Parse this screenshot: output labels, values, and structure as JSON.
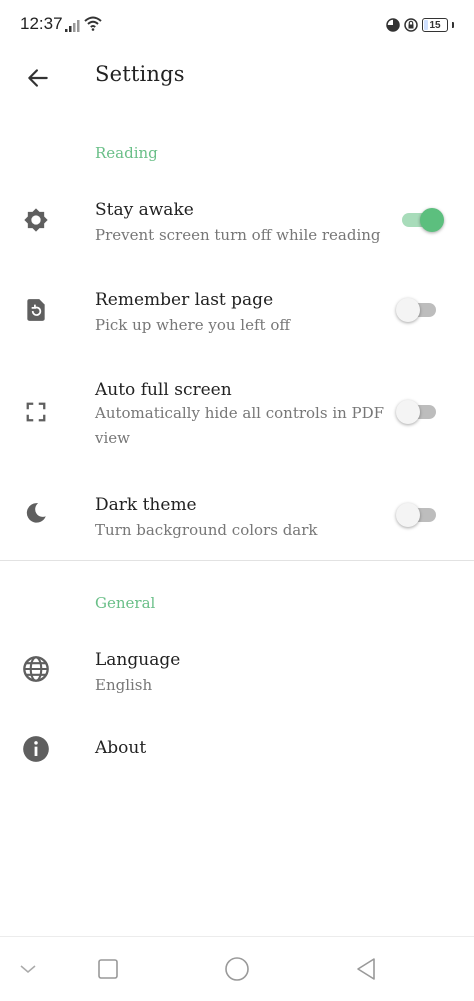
{
  "status_bar": {
    "time": "12:37",
    "battery": "15",
    "battery_percent": 15
  },
  "app_bar": {
    "title": "Settings"
  },
  "sections": {
    "reading": {
      "header": "Reading",
      "items": [
        {
          "title": "Stay awake",
          "subtitle": "Prevent screen turn off while reading",
          "icon": "brightness-gear-icon",
          "enabled": true
        },
        {
          "title": "Remember last page",
          "subtitle": "Pick up where you left off",
          "icon": "document-restore-icon",
          "enabled": false
        },
        {
          "title": "Auto full screen",
          "subtitle": "Automatically hide all controls in PDF view",
          "icon": "fullscreen-icon",
          "enabled": false
        },
        {
          "title": "Dark theme",
          "subtitle": "Turn background colors dark",
          "icon": "moon-icon",
          "enabled": false
        }
      ]
    },
    "general": {
      "header": "General",
      "items": [
        {
          "title": "Language",
          "subtitle": "English",
          "icon": "globe-icon"
        },
        {
          "title": "About",
          "icon": "info-icon"
        }
      ]
    }
  },
  "colors": {
    "accent": "#5cbf7e",
    "section_header": "#6abf88"
  }
}
